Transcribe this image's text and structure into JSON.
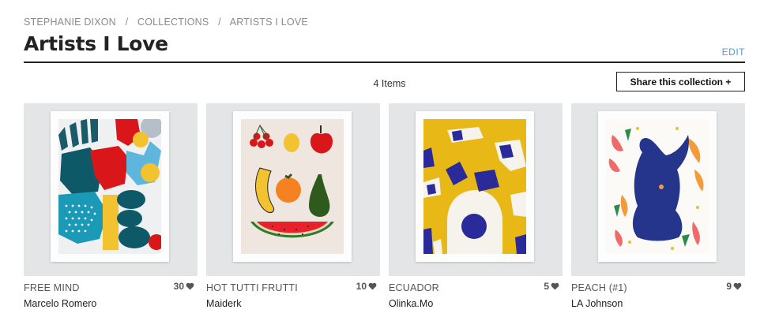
{
  "breadcrumb": {
    "user": "STEPHANIE DIXON",
    "collections": "COLLECTIONS",
    "current": "ARTISTS I LOVE",
    "separator": "/"
  },
  "page": {
    "title": "Artists I Love",
    "edit_label": "EDIT",
    "items_count": "4 Items",
    "share_label": "Share this collection +"
  },
  "colors": {
    "link": "#4a9fd4",
    "thumb_bg": "#e4e5e6",
    "heart": "#555555"
  },
  "cards": [
    {
      "title": "FREE MIND",
      "artist": "Marcelo Romero",
      "likes": "30",
      "icon": "heart-icon"
    },
    {
      "title": "HOT TUTTI FRUTTI",
      "artist": "Maiderk",
      "likes": "10",
      "icon": "heart-icon"
    },
    {
      "title": "ECUADOR",
      "artist": "Olinka.Mo",
      "likes": "5",
      "icon": "heart-icon"
    },
    {
      "title": "PEACH (#1)",
      "artist": "LA Johnson",
      "likes": "9",
      "icon": "heart-icon"
    }
  ]
}
